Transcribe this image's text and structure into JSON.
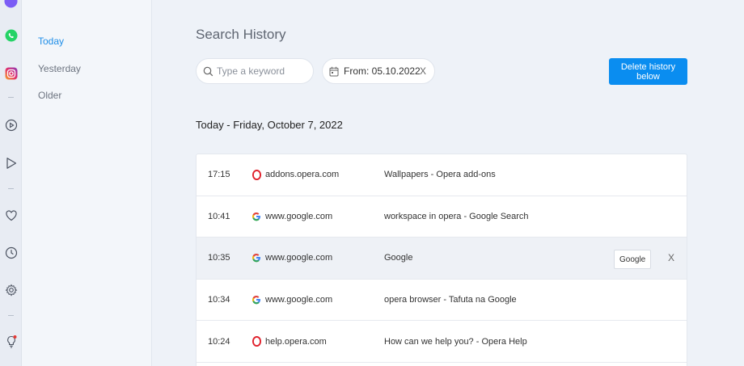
{
  "nav": {
    "items": [
      {
        "label": "Today",
        "active": true
      },
      {
        "label": "Yesterday",
        "active": false
      },
      {
        "label": "Older",
        "active": false
      }
    ]
  },
  "page": {
    "title": "Search History",
    "search_placeholder": "Type a keyword",
    "date_filter": "From: 05.10.2022",
    "date_clear": "X",
    "delete_label": "Delete history below",
    "section_heading": "Today - Friday, October 7, 2022"
  },
  "history": [
    {
      "time": "17:15",
      "icon": "opera-icon",
      "domain": "addons.opera.com",
      "title": "Wallpapers - Opera add-ons"
    },
    {
      "time": "10:41",
      "icon": "google-icon",
      "domain": "www.google.com",
      "title": "workspace in opera - Google Search"
    },
    {
      "time": "10:35",
      "icon": "google-icon",
      "domain": "www.google.com",
      "title": "Google",
      "more_label": "Google",
      "remove_label": "X"
    },
    {
      "time": "10:34",
      "icon": "google-icon",
      "domain": "www.google.com",
      "title": "opera browser - Tafuta na Google"
    },
    {
      "time": "10:24",
      "icon": "opera-icon",
      "domain": "help.opera.com",
      "title": "How can we help you? - Opera Help"
    }
  ],
  "colors": {
    "accent": "#0a8df0",
    "nav_active": "#1f8ee8",
    "opera_red": "#e0212c",
    "whatsapp_green": "#25d366"
  }
}
